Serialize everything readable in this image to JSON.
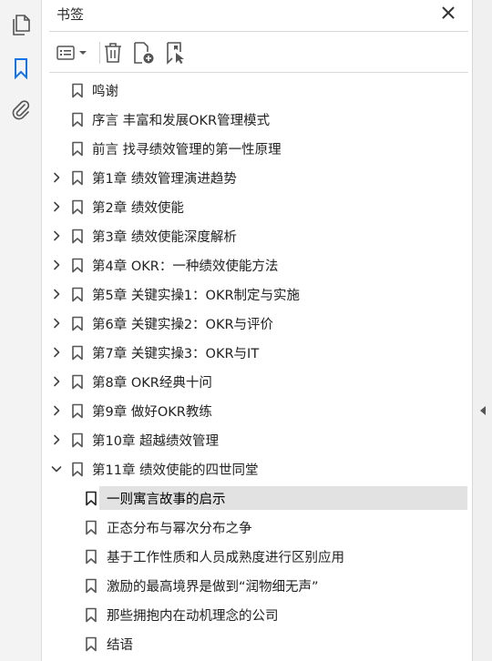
{
  "panel": {
    "title": "书签"
  },
  "nav": {
    "icons": [
      "pages-icon",
      "bookmark-icon",
      "attachment-icon"
    ]
  },
  "toolbar": {
    "icons": [
      "options-menu-icon",
      "delete-bookmark-icon",
      "new-bookmark-icon",
      "search-bookmark-icon"
    ]
  },
  "colors": {
    "accent": "#1473e6",
    "selected_bg": "#e2e2e2",
    "icon_gray": "#555555"
  },
  "bookmarks": [
    {
      "label": "鸣谢",
      "level": 0,
      "expandable": false
    },
    {
      "label": "序言 丰富和发展OKR管理模式",
      "level": 0,
      "expandable": false
    },
    {
      "label": "前言 找寻绩效管理的第一性原理",
      "level": 0,
      "expandable": false
    },
    {
      "label": "第1章 绩效管理演进趋势",
      "level": 0,
      "expandable": true,
      "expanded": false
    },
    {
      "label": "第2章 绩效使能",
      "level": 0,
      "expandable": true,
      "expanded": false
    },
    {
      "label": "第3章 绩效使能深度解析",
      "level": 0,
      "expandable": true,
      "expanded": false
    },
    {
      "label": "第4章 OKR：一种绩效使能方法",
      "level": 0,
      "expandable": true,
      "expanded": false
    },
    {
      "label": "第5章 关键实操1：OKR制定与实施",
      "level": 0,
      "expandable": true,
      "expanded": false
    },
    {
      "label": "第6章 关键实操2：OKR与评价",
      "level": 0,
      "expandable": true,
      "expanded": false
    },
    {
      "label": "第7章 关键实操3：OKR与IT",
      "level": 0,
      "expandable": true,
      "expanded": false
    },
    {
      "label": "第8章 OKR经典十问",
      "level": 0,
      "expandable": true,
      "expanded": false
    },
    {
      "label": "第9章 做好OKR教练",
      "level": 0,
      "expandable": true,
      "expanded": false
    },
    {
      "label": "第10章 超越绩效管理",
      "level": 0,
      "expandable": true,
      "expanded": false
    },
    {
      "label": "第11章 绩效使能的四世同堂",
      "level": 0,
      "expandable": true,
      "expanded": true
    },
    {
      "label": "一则寓言故事的启示",
      "level": 1,
      "expandable": false,
      "selected": true
    },
    {
      "label": "正态分布与幂次分布之争",
      "level": 1,
      "expandable": false
    },
    {
      "label": "基于工作性质和人员成熟度进行区别应用",
      "level": 1,
      "expandable": false
    },
    {
      "label": "激励的最高境界是做到“润物细无声”",
      "level": 1,
      "expandable": false
    },
    {
      "label": "那些拥抱内在动机理念的公司",
      "level": 1,
      "expandable": false
    },
    {
      "label": "结语",
      "level": 1,
      "expandable": false
    }
  ]
}
